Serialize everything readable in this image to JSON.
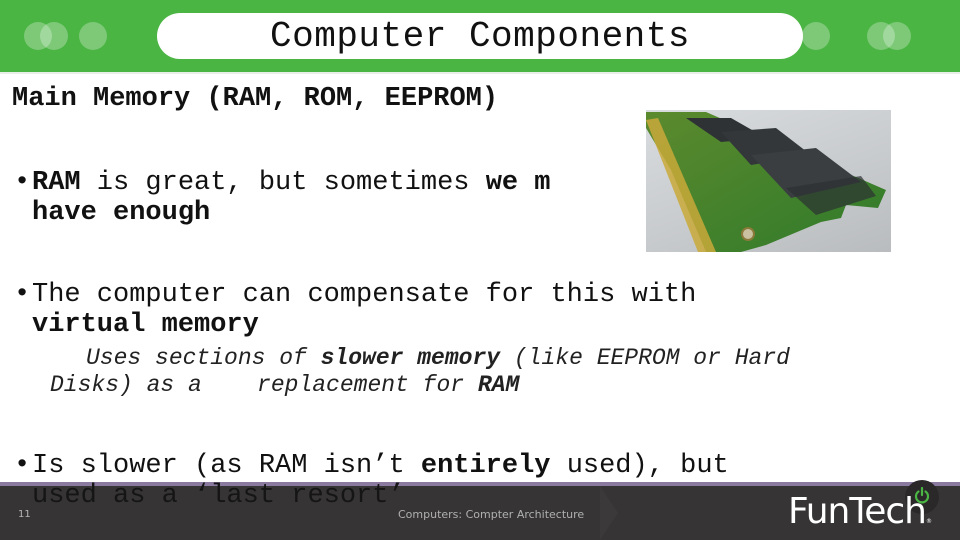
{
  "header": {
    "title": "Computer Components",
    "accent_color": "#4bb544"
  },
  "subtitle": "Main Memory (RAM, ROM, EEPROM)",
  "image": {
    "alt": "RAM memory module photo"
  },
  "bullets": [
    {
      "symbol": "•",
      "parts": [
        {
          "text": "RAM",
          "bold": true
        },
        {
          "text": " is great, but sometimes ",
          "bold": false
        },
        {
          "text": "we m",
          "bold": true
        }
      ],
      "line2": "have enough"
    },
    {
      "symbol": "•",
      "line1": "The computer can compensate for this with",
      "line2": "virtual memory"
    },
    {
      "symbol": "•",
      "line1_a": "Is slower (as RAM isn’t ",
      "line1_b": "entirely",
      "line1_c": " used), but",
      "line2": "used as a ‘last resort’"
    }
  ],
  "sub_bullet": {
    "a": "Uses sections of ",
    "b": "slower memory",
    "c": " (like EEPROM or Hard",
    "d": "Disks) as a    replacement for ",
    "e": "RAM"
  },
  "footer": {
    "slide_number": "11",
    "text": "Computers: Compter Architecture",
    "logo": "FunTech",
    "logo_mark": "®",
    "logo_accent": "#4bb544",
    "bar_color": "#363435"
  }
}
